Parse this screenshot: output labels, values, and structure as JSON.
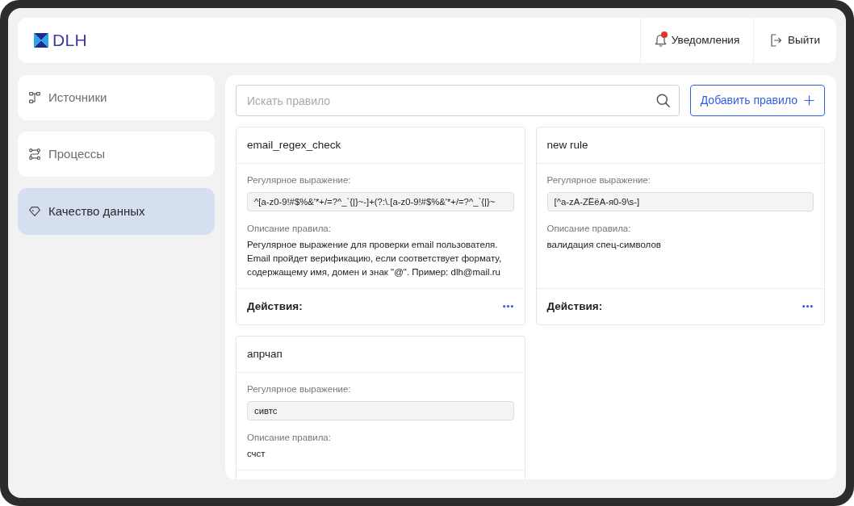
{
  "logo": {
    "text": "DLH"
  },
  "header": {
    "notifications": {
      "label": "Уведомления",
      "unread": true
    },
    "logout": {
      "label": "Выйти"
    }
  },
  "sidebar": {
    "items": [
      {
        "kind": "sources",
        "label": "Источники",
        "selected": false
      },
      {
        "kind": "processes",
        "label": "Процессы",
        "selected": false
      },
      {
        "kind": "quality",
        "label": "Качество данных",
        "selected": true
      }
    ]
  },
  "toolbar": {
    "search": {
      "placeholder": "Искать правило"
    },
    "add_button": {
      "label": "Добавить правило"
    }
  },
  "rules": [
    {
      "title": "email_regex_check",
      "regex_label": "Регулярное выражение:",
      "regex": "^[a-z0-9!#$%&'*+/=?^_`{|}~-]+(?:\\.[a-z0-9!#$%&'*+/=?^_`{|}~",
      "description_label": "Описание правила:",
      "description": "Регулярное выражение для проверки email пользователя. Email пройдет верификацию, если соответствует формату, содержащему имя, домен и знак \"@\". Пример: dlh@mail.ru",
      "actions_label": "Действия:"
    },
    {
      "title": "new rule",
      "regex_label": "Регулярное выражение:",
      "regex": "[^a-zA-ZЁёА-я0-9\\s-]",
      "description_label": "Описание правила:",
      "description": "валидация спец-символов",
      "actions_label": "Действия:"
    },
    {
      "title": "апрчап",
      "regex_label": "Регулярное выражение:",
      "regex": "сивтс",
      "description_label": "Описание правила:",
      "description": "счст"
    }
  ]
}
